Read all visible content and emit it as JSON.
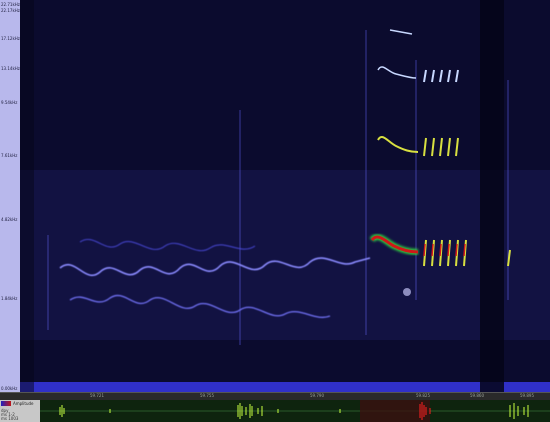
{
  "frequency_ruler": {
    "labels": [
      "22.71kHz",
      "22.17kHz",
      "17.12kHz",
      "13.14kHz",
      "9.54kHz",
      "7.61kHz",
      "4.82kHz",
      "1.84kHz",
      "0.00kHz"
    ]
  },
  "time_ruler": {
    "labels": [
      "59.721",
      "59.755",
      "59.790",
      "59.825",
      "59.860",
      "59.895"
    ]
  },
  "amplitude_panel": {
    "title": "Amplitude",
    "side_labels": [
      "dpy",
      "ms 1-2",
      "ms 1003"
    ]
  },
  "colors": {
    "background": "#0b0b2e",
    "signal_low": "#3a3ac0",
    "signal_mid": "#8a8aff",
    "signal_high": "#d01818",
    "waveform": "#c8ff40",
    "waveform_highlight": "#ff2020"
  }
}
